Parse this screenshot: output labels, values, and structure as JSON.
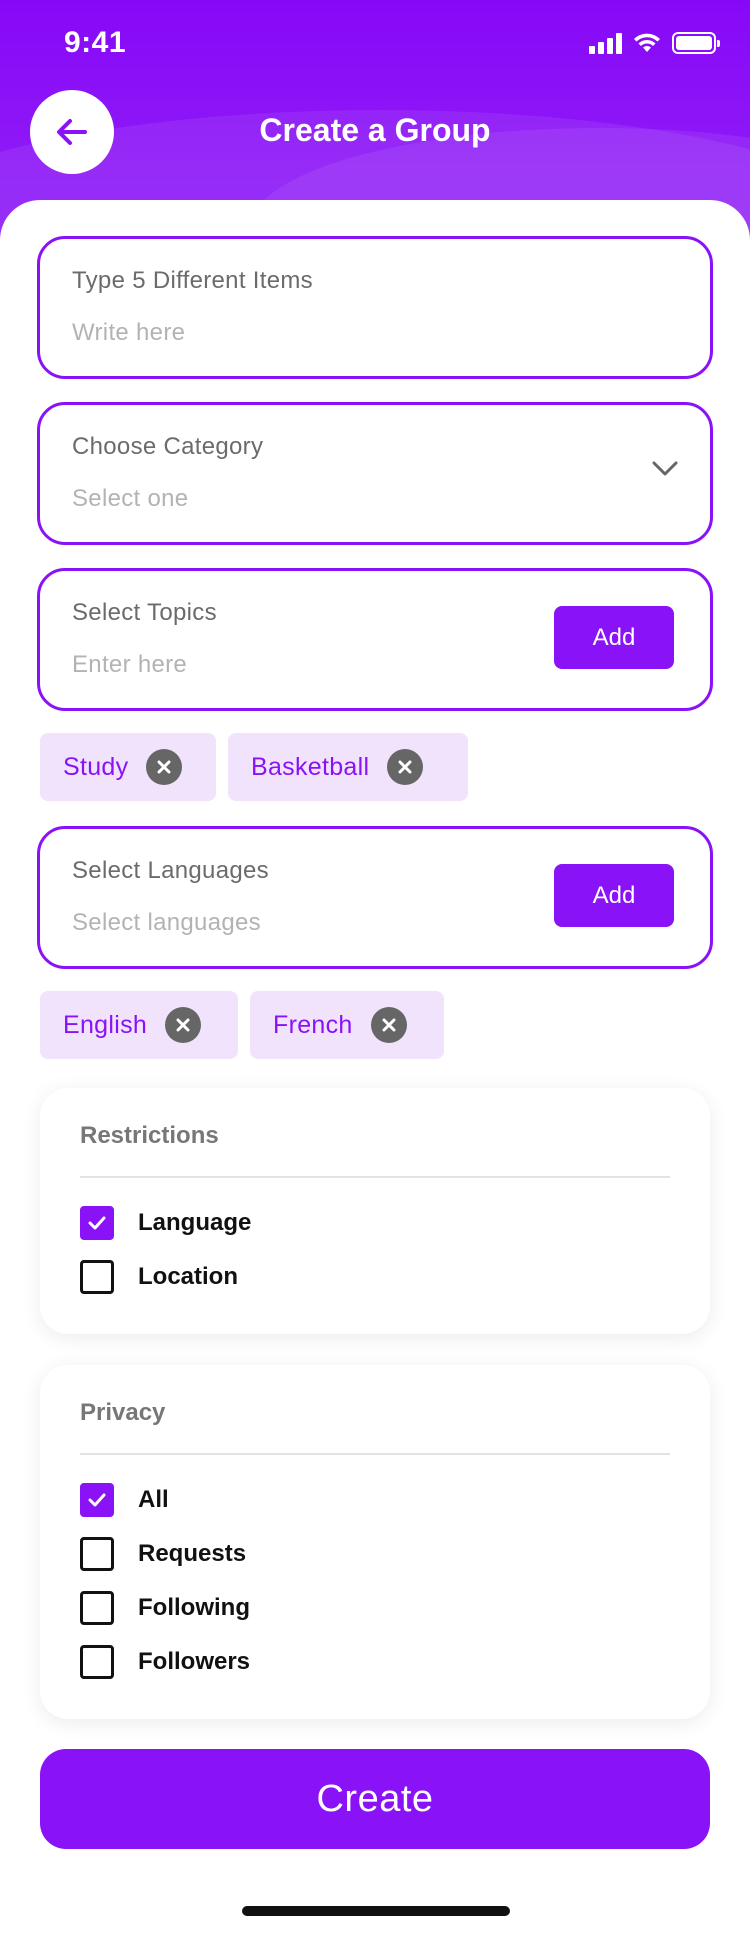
{
  "status_bar": {
    "time": "9:41"
  },
  "header": {
    "title": "Create a Group"
  },
  "fields": {
    "items": {
      "label": "Type 5 Different Items",
      "placeholder": "Write here"
    },
    "category": {
      "label": "Choose Category",
      "placeholder": "Select one"
    },
    "topics": {
      "label": "Select Topics",
      "placeholder": "Enter here",
      "add_label": "Add"
    },
    "languages": {
      "label": "Select Languages",
      "placeholder": "Select languages",
      "add_label": "Add"
    }
  },
  "topic_chips": [
    "Study",
    "Basketball"
  ],
  "language_chips": [
    "English",
    "French"
  ],
  "restrictions": {
    "title": "Restrictions",
    "options": [
      {
        "label": "Language",
        "checked": true
      },
      {
        "label": "Location",
        "checked": false
      }
    ]
  },
  "privacy": {
    "title": "Privacy",
    "options": [
      {
        "label": "All",
        "checked": true
      },
      {
        "label": "Requests",
        "checked": false
      },
      {
        "label": "Following",
        "checked": false
      },
      {
        "label": "Followers",
        "checked": false
      }
    ]
  },
  "create_button": {
    "label": "Create"
  },
  "colors": {
    "accent": "#8a12f7",
    "chip_bg": "#f2e3fc"
  }
}
